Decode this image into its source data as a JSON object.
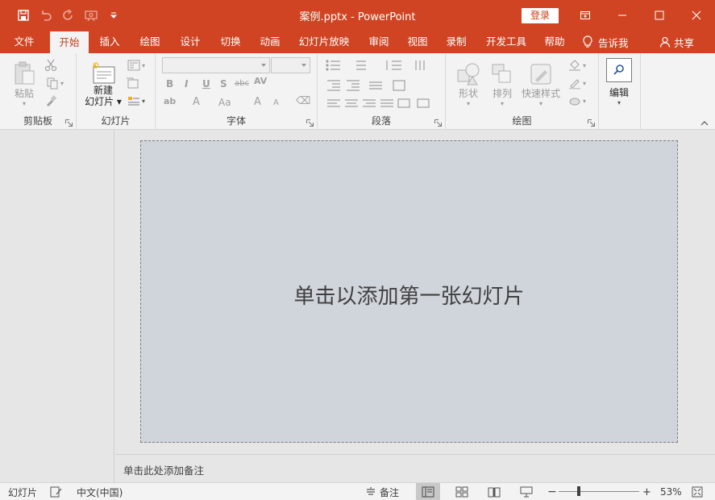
{
  "titlebar": {
    "title": "案例.pptx  -  PowerPoint",
    "login_label": "登录"
  },
  "tabs": [
    {
      "label": "文件"
    },
    {
      "label": "开始"
    },
    {
      "label": "插入"
    },
    {
      "label": "绘图"
    },
    {
      "label": "设计"
    },
    {
      "label": "切换"
    },
    {
      "label": "动画"
    },
    {
      "label": "幻灯片放映"
    },
    {
      "label": "审阅"
    },
    {
      "label": "视图"
    },
    {
      "label": "录制"
    },
    {
      "label": "开发工具"
    },
    {
      "label": "帮助"
    }
  ],
  "active_tab": "开始",
  "tellme_label": "告诉我",
  "share_label": "共享",
  "ribbon": {
    "clipboard": {
      "label": "剪贴板",
      "paste": "粘贴"
    },
    "slides": {
      "label": "幻灯片",
      "new_slide_line1": "新建",
      "new_slide_line2": "幻灯片"
    },
    "font": {
      "label": "字体"
    },
    "paragraph": {
      "label": "段落"
    },
    "drawing": {
      "label": "绘图",
      "shapes": "形状",
      "arrange": "排列",
      "quick_styles": "快速样式"
    },
    "editing": {
      "label": "编辑"
    }
  },
  "slide": {
    "placeholder": "单击以添加第一张幻灯片"
  },
  "notes": {
    "placeholder": "单击此处添加备注"
  },
  "statusbar": {
    "slide_label": "幻灯片",
    "language": "中文(中国)",
    "notes_label": "备注",
    "zoom": "53%",
    "zoom_value": 0.53
  },
  "colors": {
    "accent": "#d04423",
    "slide_bg": "#d0d4db",
    "ribbon_bg": "#f3f3f3"
  }
}
